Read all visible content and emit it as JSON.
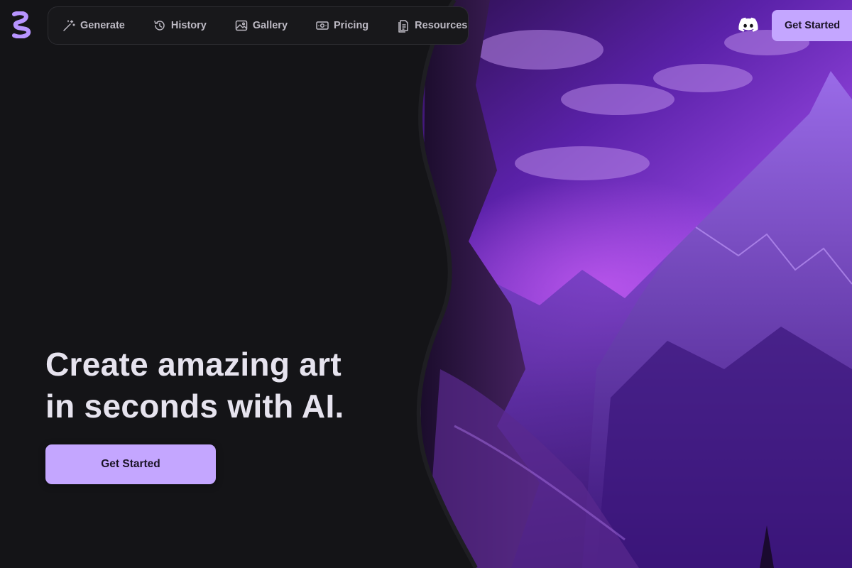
{
  "nav": {
    "items": [
      {
        "label": "Generate",
        "icon": "magic-wand-icon"
      },
      {
        "label": "History",
        "icon": "history-icon"
      },
      {
        "label": "Gallery",
        "icon": "image-icon"
      },
      {
        "label": "Pricing",
        "icon": "money-icon"
      },
      {
        "label": "Resources",
        "icon": "document-icon"
      }
    ],
    "cta_label": "Get Started",
    "discord_icon": "discord-icon",
    "logo_icon": "logo-icon"
  },
  "hero": {
    "headline_line1": "Create amazing art",
    "headline_line2": "in seconds with AI.",
    "cta_label": "Get Started",
    "art": "purple-mountain-landscape"
  },
  "colors": {
    "background": "#141417",
    "accent": "#c4a6ff",
    "nav_bg": "#18181b",
    "nav_text": "#bdbac4",
    "headline": "#e6e3ee"
  }
}
